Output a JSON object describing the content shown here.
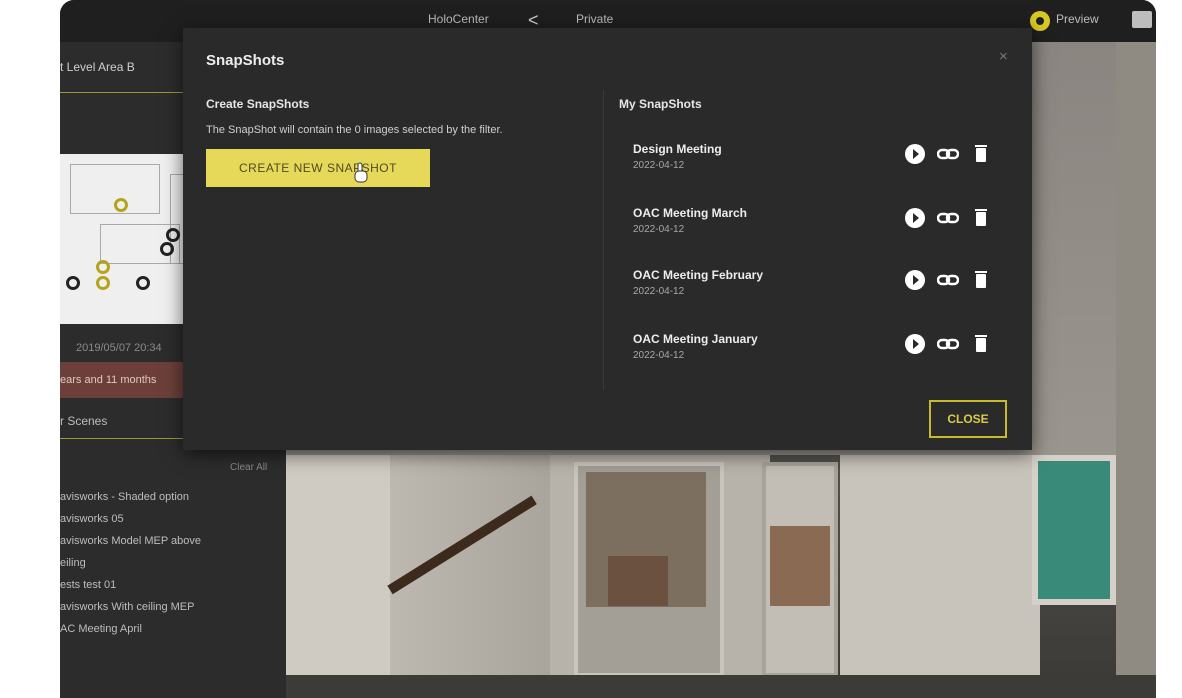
{
  "topbar": {
    "center_left": "HoloCenter",
    "center_right": "Private",
    "preview_label": "Preview"
  },
  "sidebar": {
    "level_label": "t Level Area B",
    "capture_date": "2019/05/07 20:34",
    "age_text": "ears and 11 months",
    "scenes_label": "r Scenes",
    "clear_label": "Clear All",
    "scene_items": [
      "avisworks - Shaded option",
      "avisworks 05",
      "avisworks Model MEP above",
      "eiling",
      "ests test 01",
      "avisworks With ceiling MEP",
      "AC Meeting April"
    ]
  },
  "modal": {
    "title": "SnapShots",
    "close_x": "×",
    "create_heading": "Create SnapShots",
    "create_description": "The SnapShot will contain the 0 images selected by the filter.",
    "create_button_label": "CREATE NEW SNAPSHOT",
    "my_heading": "My SnapShots",
    "snapshots": [
      {
        "name": "Design Meeting",
        "date": "2022-04-12"
      },
      {
        "name": "OAC Meeting March",
        "date": "2022-04-12"
      },
      {
        "name": "OAC Meeting February",
        "date": "2022-04-12"
      },
      {
        "name": "OAC Meeting January",
        "date": "2022-04-12"
      }
    ],
    "close_button_label": "CLOSE",
    "icons": {
      "play": "play-icon",
      "link": "link-icon",
      "delete": "trash-icon"
    }
  },
  "colors": {
    "accent_yellow": "#e6d95a",
    "close_border": "#c8ba2c",
    "modal_bg": "#2a2a2a",
    "topbar_bg": "#1f1f1f"
  }
}
